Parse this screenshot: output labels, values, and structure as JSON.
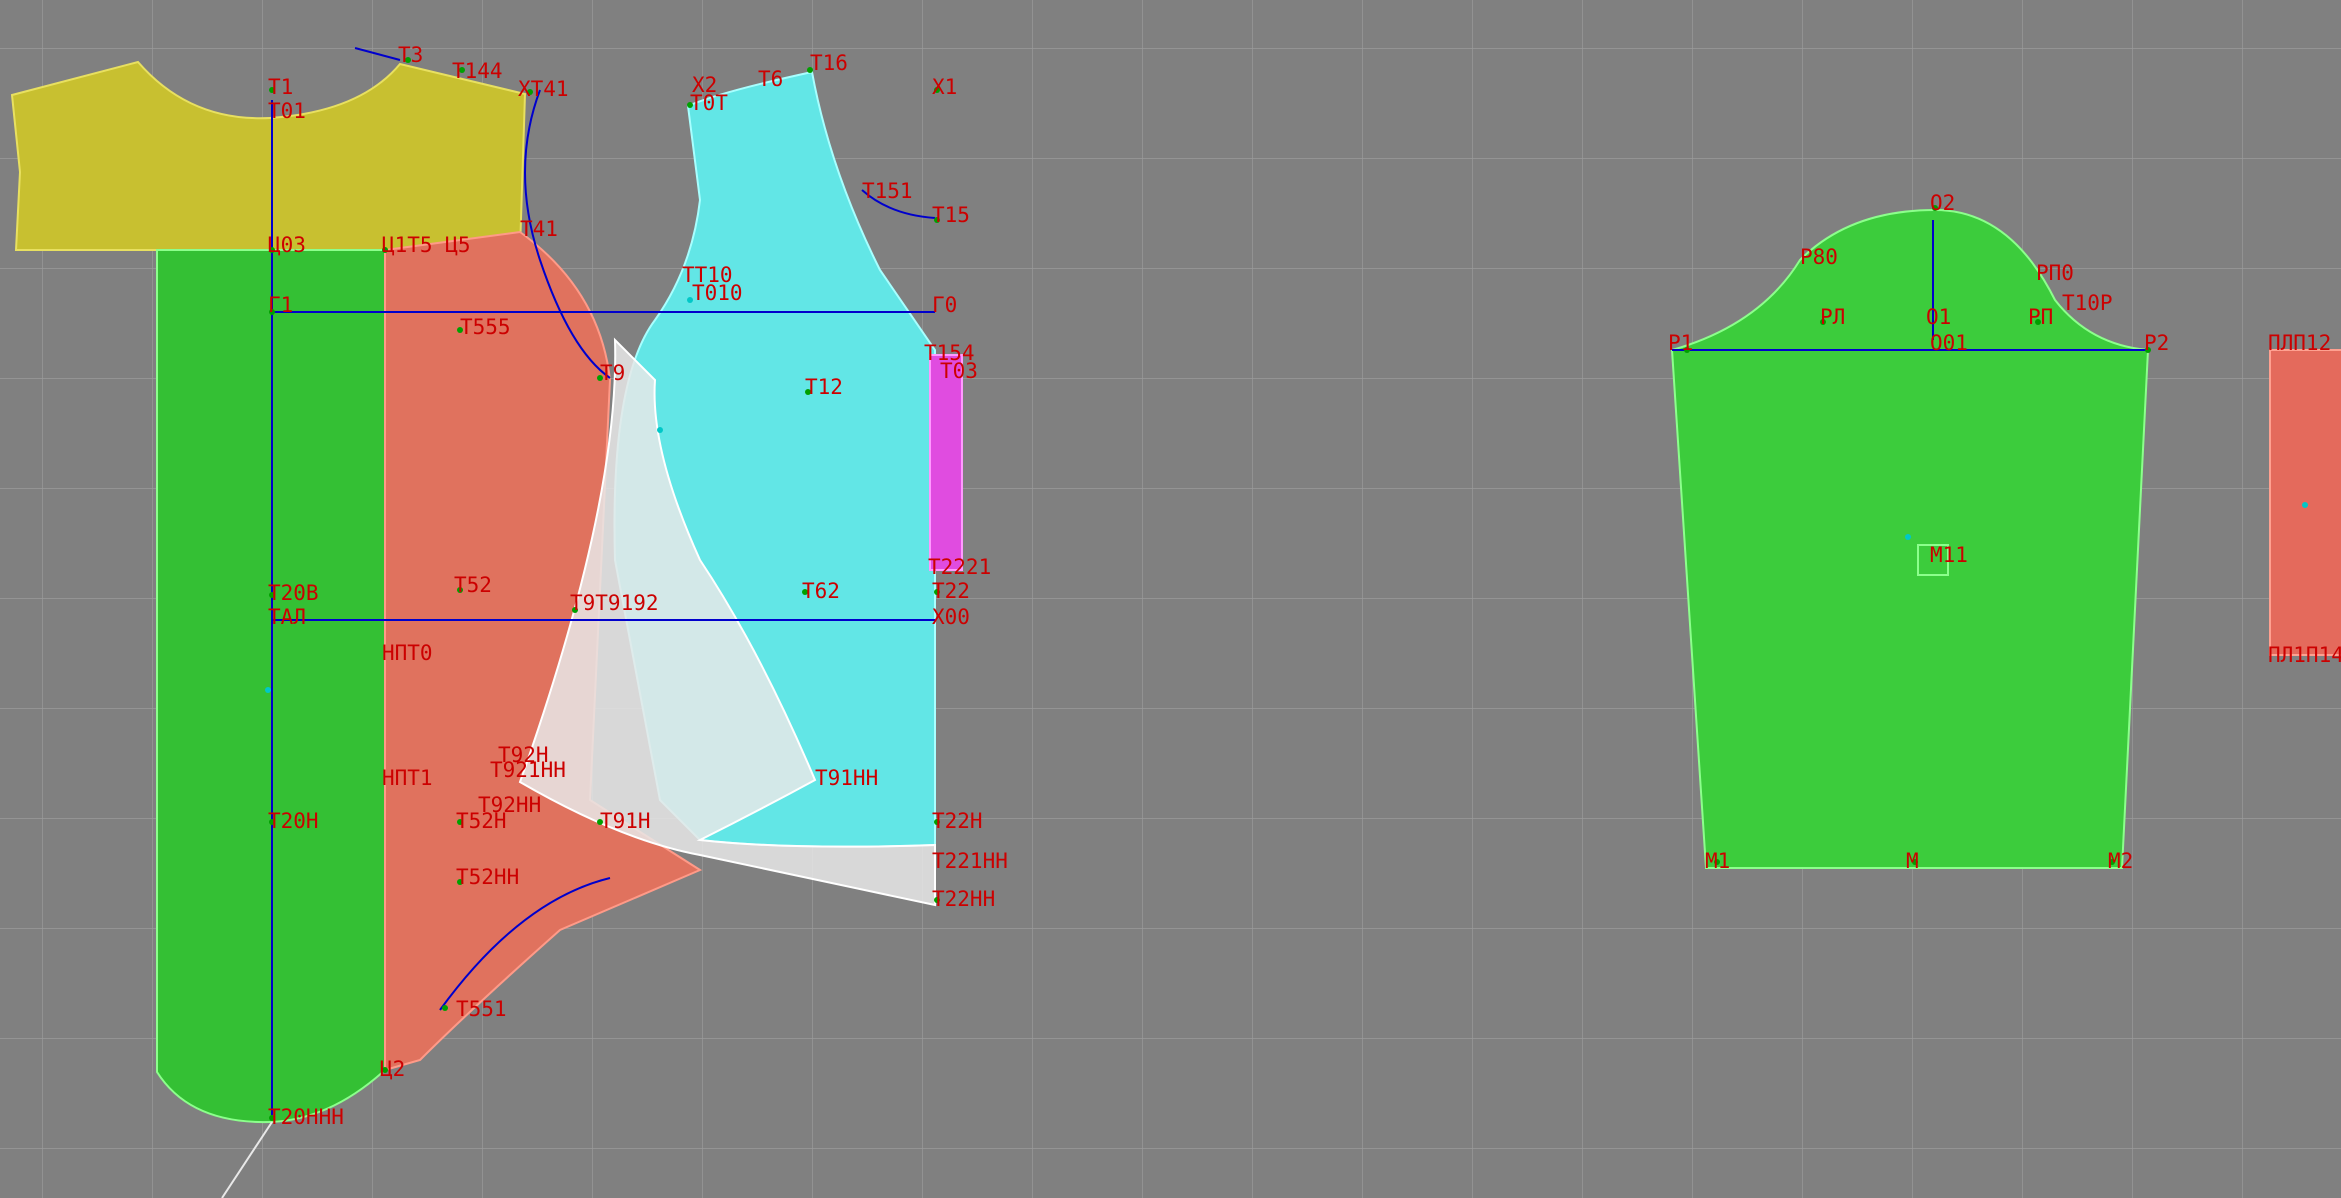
{
  "colors": {
    "background": "#808080",
    "grid": "#9a9a9a",
    "yoke": "#c8c030",
    "center_back": "#34c034",
    "side_panel": "#e0725e",
    "front": "#62e6e6",
    "facing": "#e8e8e8",
    "placket": "#e04ce0",
    "sleeve": "#3ccc3c",
    "cuff": "#e46a5c",
    "label": "#cc0000",
    "construction_line": "#0000cc"
  },
  "icons": [
    "grid-canvas",
    "piece-outline",
    "point-marker",
    "construction-line"
  ],
  "pieces": {
    "yoke": "yoke-piece",
    "center_back": "center-back-piece",
    "side_panel": "side-panel-piece",
    "front": "front-piece",
    "facing": "front-facing-piece",
    "placket": "placket-piece",
    "sleeve": "sleeve-piece",
    "cuff": "cuff-piece"
  },
  "labels": {
    "T1": "T1",
    "T3": "T3",
    "T144": "T144",
    "XT41": "XT41",
    "X2": "X2",
    "T6": "T6",
    "T16": "T16",
    "X1": "X1",
    "T01": "T01",
    "T0T": "T0T",
    "T151": "T151",
    "T15": "T15",
    "U03": "Ц03",
    "U1T5": "Ц1Т5 Ц5",
    "T41": "T41",
    "TT10": "TT10",
    "T010": "T010",
    "G1": "Г1",
    "G0": "Г0",
    "T555": "T555",
    "T9": "T9",
    "T154": "T154",
    "T12": "T12",
    "T03": "T03",
    "T20B": "T20B",
    "T52": "T52",
    "T62": "T62",
    "T9192": "T9T9192",
    "T22": "T22",
    "T221": "T2221",
    "TAL": "TAЛ",
    "X00": "X00",
    "NPT0": "НПТ0",
    "NPT1": "НПТ1",
    "T92N": "T92H",
    "T921NN": "T921HH",
    "T91NN": "T91HH",
    "T92NN": "T92HH",
    "T20N": "T20H",
    "T52N": "T52H",
    "T91N": "T91H",
    "T22N": "T22H",
    "T221NN": "T221HH",
    "T52NN": "T52HH",
    "T22NN": "T22HH",
    "T551": "T551",
    "U2": "Ц2",
    "T20NN": "T20HHH",
    "O2": "O2",
    "R80": "P80",
    "RP0": "PП0",
    "R1": "P1",
    "RL": "PЛ",
    "O1": "O1",
    "RP": "PП",
    "T10R": "T10P",
    "O01": "O01",
    "R2": "P2",
    "M11": "M11",
    "M1": "M1",
    "M": "M",
    "M2": "M2",
    "PL": "ПЛП12",
    "PLN": "ПЛ1П14"
  }
}
